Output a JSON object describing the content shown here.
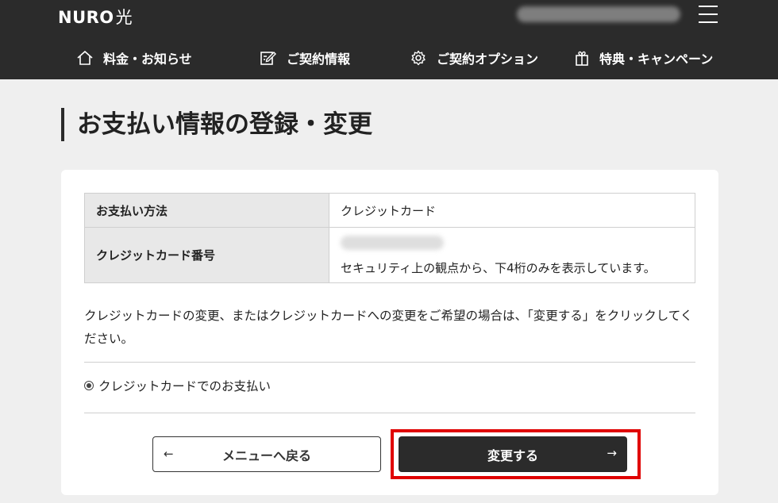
{
  "header": {
    "logo_text": "NURO",
    "logo_kanji": "光",
    "user_name": "●●●●●●● ●●●●●● ●●",
    "nav": [
      {
        "label": "料金・お知らせ",
        "icon": "home-icon"
      },
      {
        "label": "ご契約情報",
        "icon": "edit-icon"
      },
      {
        "label": "ご契約オプション",
        "icon": "gear-icon"
      },
      {
        "label": "特典・キャンペーン",
        "icon": "gift-icon"
      }
    ]
  },
  "main": {
    "page_title": "お支払い情報の登録・変更",
    "table": {
      "row1": {
        "label": "お支払い方法",
        "value": "クレジットカード"
      },
      "row2": {
        "label": "クレジットカード番号",
        "masked_number": "●●●●●●●●●",
        "note": "セキュリティ上の観点から、下4桁のみを表示しています。"
      }
    },
    "description": "クレジットカードの変更、またはクレジットカードへの変更をご希望の場合は、「変更する」をクリックしてください。",
    "radio_option": "クレジットカードでのお支払い",
    "back_button": "メニューへ戻る",
    "back_arrow": "←",
    "change_button": "変更する",
    "change_arrow": "→"
  },
  "colors": {
    "header_bg": "#2b2b2b",
    "page_bg": "#efefef",
    "highlight": "#e00000"
  }
}
